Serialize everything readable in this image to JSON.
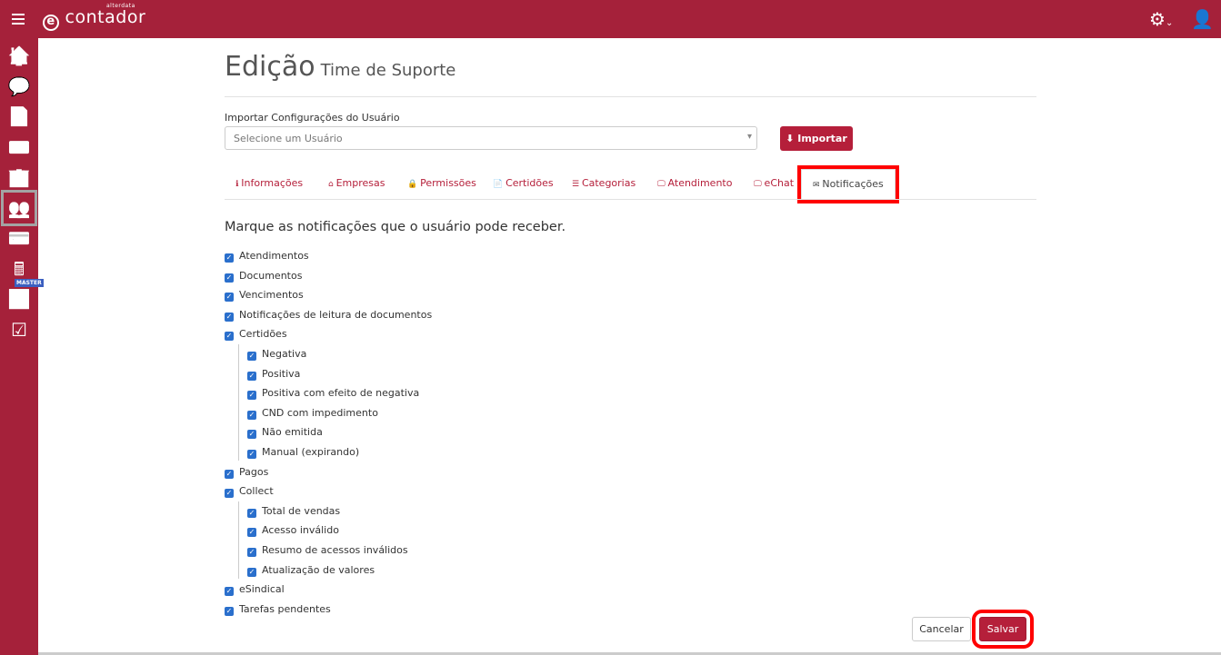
{
  "header": {
    "brand": "contador",
    "brand_sub": "alterdata",
    "icons": [
      "menu-icon",
      "gear-icon",
      "user-icon"
    ]
  },
  "sidebar": {
    "items": [
      "home",
      "chat",
      "document",
      "contact-card",
      "building",
      "users",
      "credit-card",
      "calculator",
      "chart",
      "checklist"
    ],
    "badge": "MASTER",
    "active": "users"
  },
  "page": {
    "title": "Edição",
    "subtitle": "Time de Suporte"
  },
  "import": {
    "label": "Importar Configurações do Usuário",
    "placeholder": "Selecione um Usuário",
    "button": "Importar"
  },
  "tabs": [
    {
      "icon": "ℹ",
      "label": "Informações"
    },
    {
      "icon": "⌂",
      "label": "Empresas"
    },
    {
      "icon": "🔒",
      "label": "Permissões"
    },
    {
      "icon": "📄",
      "label": "Certidões"
    },
    {
      "icon": "☰",
      "label": "Categorias"
    },
    {
      "icon": "🖵",
      "label": "Atendimento"
    },
    {
      "icon": "🖵",
      "label": "eChat"
    },
    {
      "icon": "✉",
      "label": "Notificações"
    }
  ],
  "heading": "Marque as notificações que o usuário pode receber.",
  "notifications": [
    {
      "label": "Atendimentos",
      "level": 0,
      "checked": true
    },
    {
      "label": "Documentos",
      "level": 0,
      "checked": true
    },
    {
      "label": "Vencimentos",
      "level": 0,
      "checked": true
    },
    {
      "label": "Notificações de leitura de documentos",
      "level": 0,
      "checked": true
    },
    {
      "label": "Certidões",
      "level": 0,
      "checked": true
    },
    {
      "label": "Negativa",
      "level": 1,
      "checked": true
    },
    {
      "label": "Positiva",
      "level": 1,
      "checked": true
    },
    {
      "label": "Positiva com efeito de negativa",
      "level": 1,
      "checked": true
    },
    {
      "label": "CND com impedimento",
      "level": 1,
      "checked": true
    },
    {
      "label": "Não emitida",
      "level": 1,
      "checked": true
    },
    {
      "label": "Manual (expirando)",
      "level": 1,
      "checked": true
    },
    {
      "label": "Pagos",
      "level": 0,
      "checked": true
    },
    {
      "label": "Collect",
      "level": 0,
      "checked": true
    },
    {
      "label": "Total de vendas",
      "level": 1,
      "checked": true
    },
    {
      "label": "Acesso inválido",
      "level": 1,
      "checked": true
    },
    {
      "label": "Resumo de acessos inválidos",
      "level": 1,
      "checked": true
    },
    {
      "label": "Atualização de valores",
      "level": 1,
      "checked": true
    },
    {
      "label": "eSindical",
      "level": 0,
      "checked": true
    },
    {
      "label": "Tarefas pendentes",
      "level": 0,
      "checked": true
    }
  ],
  "actions": {
    "cancel": "Cancelar",
    "save": "Salvar"
  }
}
